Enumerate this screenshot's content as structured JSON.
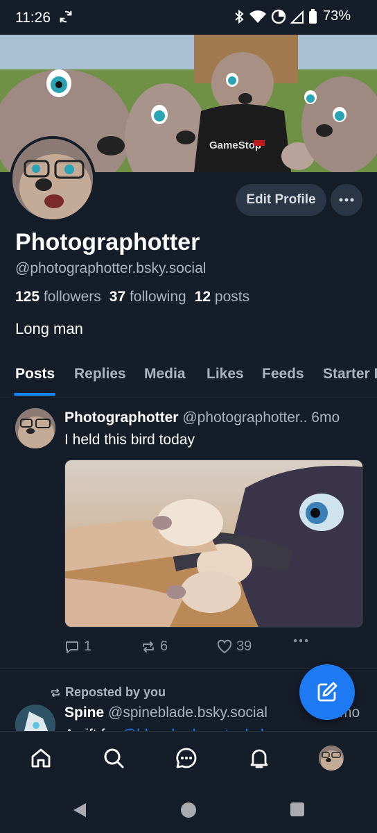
{
  "status_bar": {
    "time": "11:26",
    "battery": "73%",
    "sync_icon": "sync-icon",
    "icons": [
      "bluetooth-icon",
      "wifi-icon",
      "data-saver-icon",
      "signal-icon",
      "battery-icon"
    ]
  },
  "profile": {
    "display_name": "Photographotter",
    "handle": "@photographotter.bsky.social",
    "followers_count": "125",
    "followers_label": "followers",
    "following_count": "37",
    "following_label": "following",
    "posts_count": "12",
    "posts_label": "posts",
    "bio": "Long man",
    "banner_text": "GameStop",
    "edit_label": "Edit Profile"
  },
  "tabs": [
    {
      "label": "Posts",
      "active": true
    },
    {
      "label": "Replies",
      "active": false
    },
    {
      "label": "Media",
      "active": false
    },
    {
      "label": "Likes",
      "active": false
    },
    {
      "label": "Feeds",
      "active": false
    },
    {
      "label": "Starter P",
      "active": false
    }
  ],
  "feed": {
    "post1": {
      "author": "Photographotter",
      "handle": "@photographotter..",
      "time": "6mo",
      "text": "I held this bird today",
      "replies": "1",
      "reposts": "6",
      "likes": "39"
    },
    "post2": {
      "repost_label": "Reposted by you",
      "author": "Spine",
      "handle": "@spineblade.bsky.social",
      "time": "mo",
      "text_prefix": "A gift for ",
      "text_link": "@blueshaderaptor.bsky",
      "text_suffix": "..."
    }
  },
  "colors": {
    "background": "#151d28",
    "accent": "#1083fe",
    "fab": "#1d7af2",
    "button": "#2a3645",
    "muted_text": "#aab4c0"
  },
  "bottom_nav": [
    "home-icon",
    "search-icon",
    "chat-icon",
    "bell-icon",
    "profile-avatar"
  ],
  "system_nav": [
    "back-button",
    "home-button",
    "recents-button"
  ]
}
